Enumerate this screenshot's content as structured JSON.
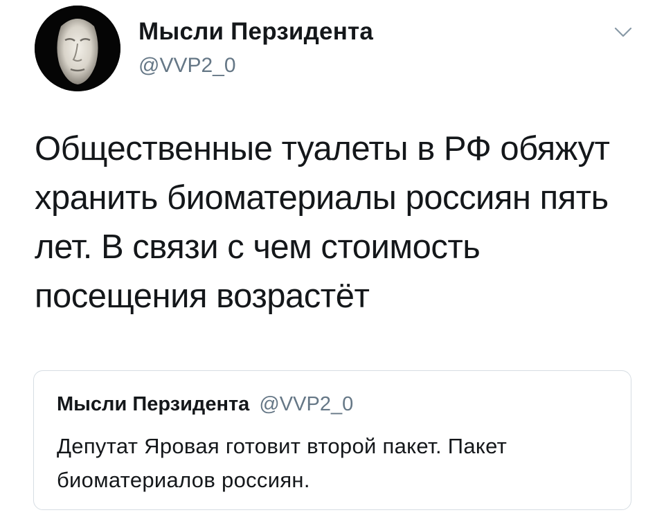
{
  "tweet": {
    "author_name": "Мысли Перзидента",
    "author_handle": "@VVP2_0",
    "avatar_icon": "death-mask-avatar",
    "menu_icon": "chevron-down-icon",
    "text": "Общественные туалеты в РФ обяжут хранить биоматериалы россиян пять лет. В связи с чем стоимость посещения возрастёт"
  },
  "quoted_tweet": {
    "author_name": "Мысли Перзидента",
    "author_handle": "@VVP2_0",
    "text": "Депутат Яровая готовит второй пакет. Пакет биоматериалов россиян."
  },
  "colors": {
    "text_primary": "#14171a",
    "text_secondary": "#657786",
    "border": "#d6dde3"
  }
}
